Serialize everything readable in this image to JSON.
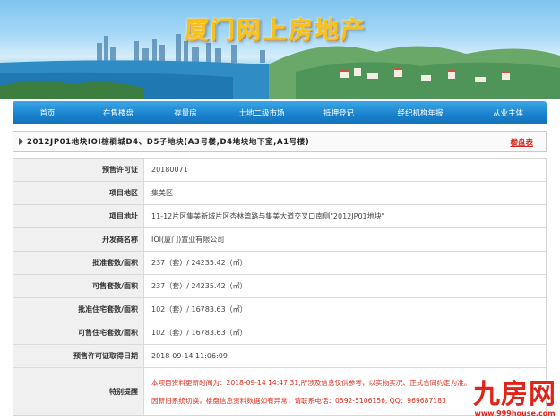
{
  "banner": {
    "title": "厦门网上房地产"
  },
  "nav": {
    "items": [
      "首页",
      "在售楼盘",
      "存量房",
      "土地二级市场",
      "抵押登记",
      "经纪机构年报",
      "从业主体"
    ]
  },
  "project": {
    "title": "2012JP01地块IOI棕榈城D4、D5子地块(A3号楼,D4地块地下室,A1号楼)",
    "link_label": "楼盘表"
  },
  "info": {
    "rows": [
      {
        "label": "预售许可证",
        "value": "20180071"
      },
      {
        "label": "项目地区",
        "value": "集美区"
      },
      {
        "label": "项目地址",
        "value": "11-12片区集美新城片区杏林湾路与集美大道交叉口南侧\"2012JP01地块\""
      },
      {
        "label": "开发商名称",
        "value": "IOI(厦门)置业有限公司"
      },
      {
        "label": "批准套数/面积",
        "value": "237（套）/ 24235.42（㎡）"
      },
      {
        "label": "可售套数/面积",
        "value": "237（套）/ 24235.42（㎡）"
      },
      {
        "label": "批准住宅套数/面积",
        "value": "102（套）/ 16783.63（㎡）"
      },
      {
        "label": "可售住宅套数/面积",
        "value": "102（套）/ 16783.63（㎡）"
      },
      {
        "label": "预售许可证取得日期",
        "value": "2018-09-14 11:06:09"
      }
    ],
    "notice_label": "特别提醒",
    "notice_line1": "本项目资料更新时间为：2018-09-14 14:47:31,所涉及信息仅供参考，以实物实况、正式合同约定为准。",
    "notice_line2": "因新旧系统切换，楼盘信息资料数据如有异常，请联系电话：0592-5106156, QQ：969687183"
  },
  "watermark": {
    "logo": "九房网",
    "url": "www.999house.com"
  },
  "colors": {
    "nav_bg": "#1b84cf",
    "accent_red": "#d8251b",
    "label_bg": "#f0f0f0"
  }
}
